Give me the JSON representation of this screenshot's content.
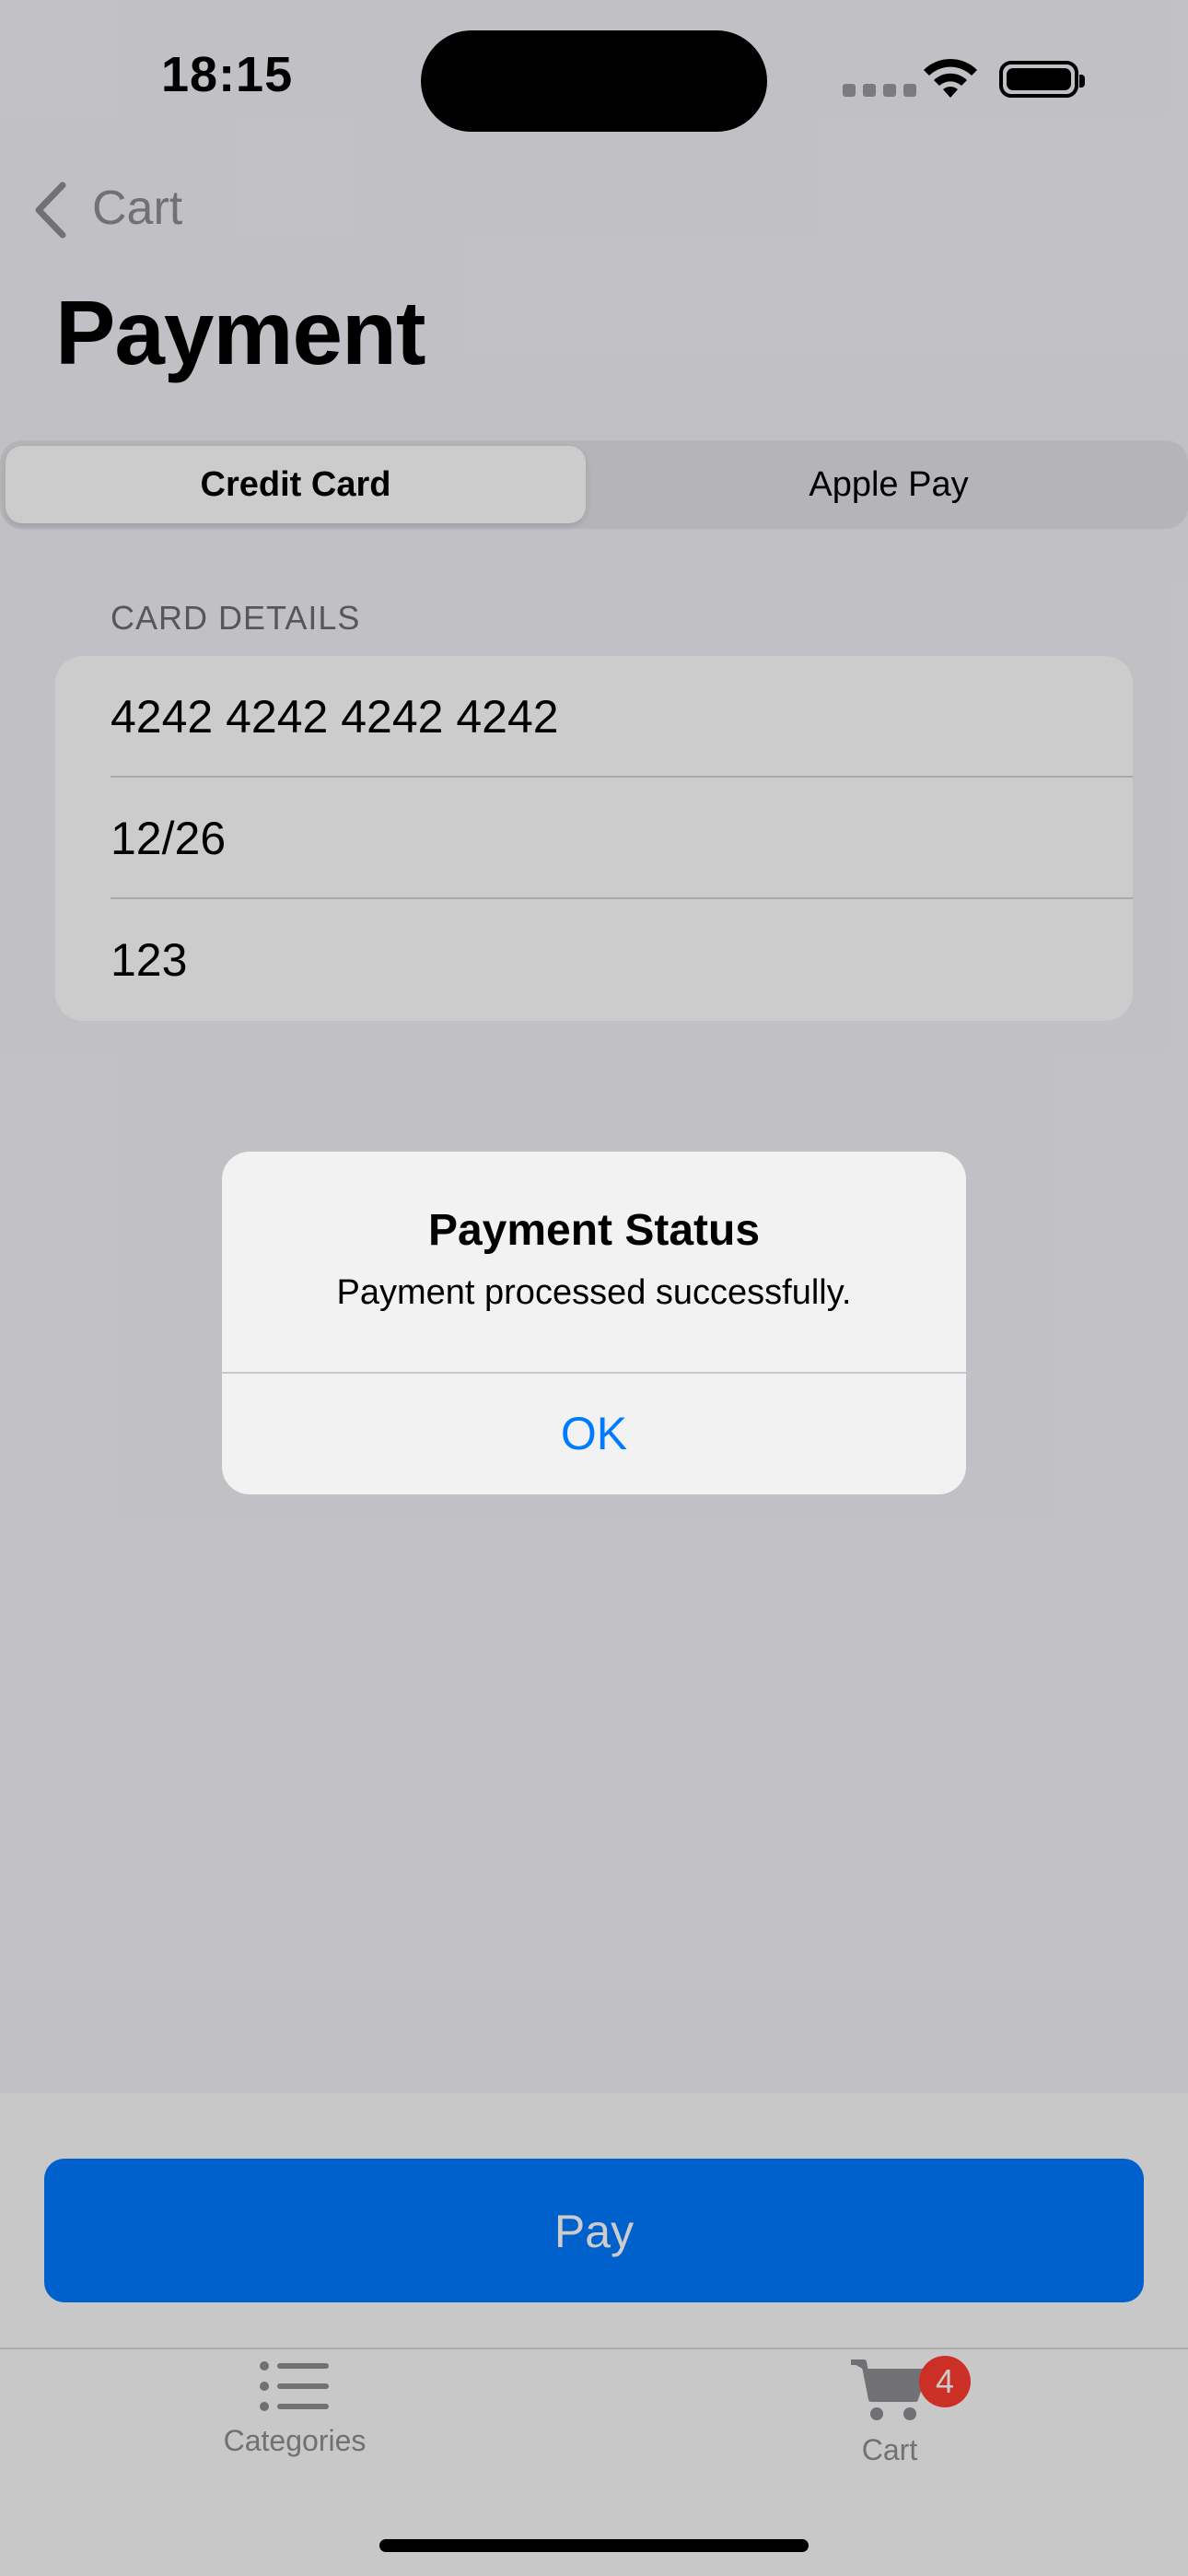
{
  "status_bar": {
    "time": "18:15"
  },
  "nav": {
    "back_label": "Cart",
    "title": "Payment"
  },
  "segmented": {
    "options": [
      {
        "label": "Credit Card",
        "selected": true
      },
      {
        "label": "Apple Pay",
        "selected": false
      }
    ]
  },
  "card_details": {
    "header": "CARD DETAILS",
    "card_number": "4242 4242 4242 4242",
    "expiry": "12/26",
    "cvc": "123"
  },
  "pay_button": {
    "label": "Pay"
  },
  "tab_bar": {
    "items": [
      {
        "label": "Categories",
        "icon": "list-icon"
      },
      {
        "label": "Cart",
        "icon": "cart-icon",
        "badge": "4"
      }
    ]
  },
  "alert": {
    "title": "Payment Status",
    "message": "Payment processed successfully.",
    "ok_label": "OK"
  },
  "colors": {
    "accent": "#007aff",
    "badge": "#ff3b30"
  }
}
